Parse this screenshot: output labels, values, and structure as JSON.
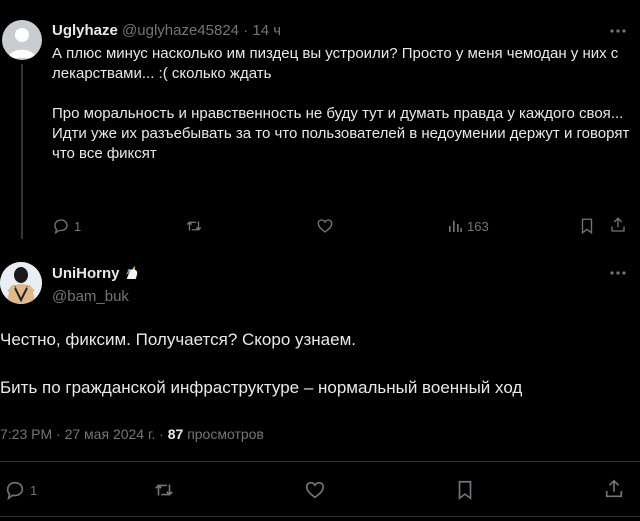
{
  "reply": {
    "display_name": "Uglyhaze",
    "handle": "@uglyhaze45824",
    "separator": "·",
    "time": "14 ч",
    "text": "А плюс минус насколько им пиздец вы устроили? Просто у меня чемодан у них с лекарствами... :( сколько ждать\n\nПро моральность и нравственность не буду тут и думать правда у каждого своя...\nИдти уже их разъебывать за то что пользователей в недоумении держут и говорят что все фиксят",
    "actions": {
      "replies": "1",
      "views": "163"
    }
  },
  "main": {
    "display_name": "UniHorny",
    "handle": "@bam_buk",
    "text": "Честно, фиксим. Получается? Скоро узнаем.\n\nБить по гражданской инфраструктуре – нормальный военный ход",
    "time": "7:23 PM",
    "separator": "·",
    "date": "27 мая 2024 г.",
    "views_count": "87",
    "views_label": "просмотров",
    "actions": {
      "replies": "1"
    }
  },
  "icons": [
    "more-icon",
    "reply-icon",
    "retweet-icon",
    "like-icon",
    "views-icon",
    "bookmark-icon",
    "share-icon",
    "unicorn-icon"
  ],
  "colors": {
    "background": "#000000",
    "text": "#e7e9ea",
    "muted": "#71767b",
    "divider": "#2f3336"
  }
}
